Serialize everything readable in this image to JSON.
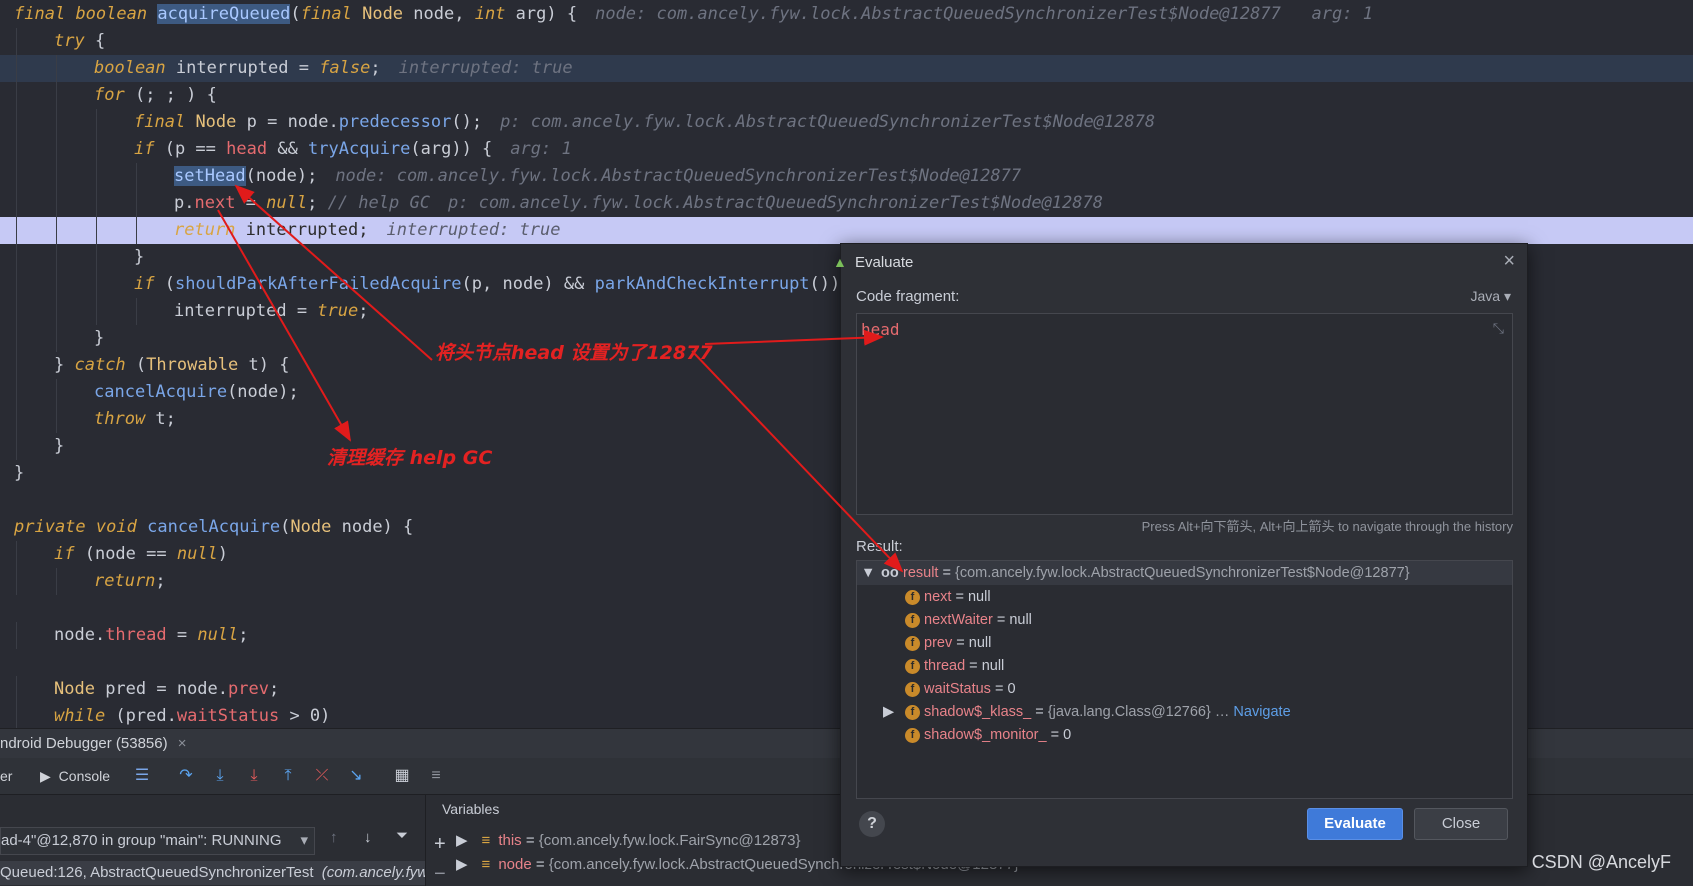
{
  "code_lines": [
    {
      "indent": 0,
      "parts": [
        [
          "kw",
          "final"
        ],
        [
          "t",
          " "
        ],
        [
          "kw",
          "boolean"
        ],
        [
          "t",
          " "
        ],
        [
          "hl",
          "acquireQueued"
        ],
        [
          "t",
          "("
        ],
        [
          "kw",
          "final"
        ],
        [
          "t",
          " "
        ],
        [
          "ty",
          "Node"
        ],
        [
          "t",
          " node, "
        ],
        [
          "kw",
          "int"
        ],
        [
          "t",
          " arg) {"
        ]
      ],
      "hint": "node: com.ancely.fyw.lock.AbstractQueuedSynchronizerTest$Node@12877   arg: 1"
    },
    {
      "indent": 1,
      "parts": [
        [
          "kw",
          "try"
        ],
        [
          "t",
          " {"
        ]
      ],
      "hint": ""
    },
    {
      "indent": 2,
      "parts": [
        [
          "kw",
          "boolean"
        ],
        [
          "t",
          " interrupted = "
        ],
        [
          "lit",
          "false"
        ],
        [
          "t",
          ";"
        ]
      ],
      "hint": "interrupted: true",
      "sel": true
    },
    {
      "indent": 2,
      "parts": [
        [
          "kw",
          "for"
        ],
        [
          "t",
          " (; ; ) {"
        ]
      ],
      "hint": ""
    },
    {
      "indent": 3,
      "parts": [
        [
          "kw",
          "final"
        ],
        [
          "t",
          " "
        ],
        [
          "ty",
          "Node"
        ],
        [
          "t",
          " p = node."
        ],
        [
          "fn",
          "predecessor"
        ],
        [
          "t",
          "();"
        ]
      ],
      "hint": "p: com.ancely.fyw.lock.AbstractQueuedSynchronizerTest$Node@12878"
    },
    {
      "indent": 3,
      "parts": [
        [
          "kw",
          "if"
        ],
        [
          "t",
          " (p == "
        ],
        [
          "fld",
          "head"
        ],
        [
          "t",
          " && "
        ],
        [
          "fn",
          "tryAcquire"
        ],
        [
          "t",
          "(arg)) {"
        ]
      ],
      "hint": "arg: 1"
    },
    {
      "indent": 4,
      "parts": [
        [
          "hl",
          "setHead"
        ],
        [
          "t",
          "(node);"
        ]
      ],
      "hint": "node: com.ancely.fyw.lock.AbstractQueuedSynchronizerTest$Node@12877"
    },
    {
      "indent": 4,
      "parts": [
        [
          "t",
          "p."
        ],
        [
          "fld",
          "next"
        ],
        [
          "t",
          " = "
        ],
        [
          "lit",
          "null"
        ],
        [
          "t",
          "; "
        ],
        [
          "hint0",
          "// help GC"
        ]
      ],
      "hint": "p: com.ancely.fyw.lock.AbstractQueuedSynchronizerTest$Node@12878"
    },
    {
      "indent": 4,
      "parts": [
        [
          "kw",
          "return"
        ],
        [
          "t",
          " interrupted;"
        ]
      ],
      "hint": "interrupted: true",
      "cur": true
    },
    {
      "indent": 3,
      "parts": [
        [
          "t",
          "}"
        ]
      ],
      "hint": ""
    },
    {
      "indent": 3,
      "parts": [
        [
          "kw",
          "if"
        ],
        [
          "t",
          " ("
        ],
        [
          "fn",
          "shouldParkAfterFailedAcquire"
        ],
        [
          "t",
          "(p, node) && "
        ],
        [
          "fn",
          "parkAndCheckInterrupt"
        ],
        [
          "t",
          "())"
        ]
      ],
      "hint": ""
    },
    {
      "indent": 4,
      "parts": [
        [
          "t",
          "interrupted = "
        ],
        [
          "lit",
          "true"
        ],
        [
          "t",
          ";"
        ]
      ],
      "hint": ""
    },
    {
      "indent": 2,
      "parts": [
        [
          "t",
          "}"
        ]
      ],
      "hint": ""
    },
    {
      "indent": 1,
      "parts": [
        [
          "t",
          "} "
        ],
        [
          "kw",
          "catch"
        ],
        [
          "t",
          " ("
        ],
        [
          "ty",
          "Throwable"
        ],
        [
          "t",
          " t) {"
        ]
      ],
      "hint": ""
    },
    {
      "indent": 2,
      "parts": [
        [
          "fn",
          "cancelAcquire"
        ],
        [
          "t",
          "(node);"
        ]
      ],
      "hint": ""
    },
    {
      "indent": 2,
      "parts": [
        [
          "kw",
          "throw"
        ],
        [
          "t",
          " t;"
        ]
      ],
      "hint": ""
    },
    {
      "indent": 1,
      "parts": [
        [
          "t",
          "}"
        ]
      ],
      "hint": ""
    },
    {
      "indent": 0,
      "parts": [
        [
          "t",
          "}"
        ]
      ],
      "hint": ""
    },
    {
      "indent": 0,
      "parts": [],
      "hint": ""
    },
    {
      "indent": 0,
      "parts": [
        [
          "kw",
          "private"
        ],
        [
          "t",
          " "
        ],
        [
          "kw",
          "void"
        ],
        [
          "t",
          " "
        ],
        [
          "fn",
          "cancelAcquire"
        ],
        [
          "t",
          "("
        ],
        [
          "ty",
          "Node"
        ],
        [
          "t",
          " node) {"
        ]
      ],
      "hint": ""
    },
    {
      "indent": 1,
      "parts": [
        [
          "kw",
          "if"
        ],
        [
          "t",
          " (node == "
        ],
        [
          "lit",
          "null"
        ],
        [
          "t",
          ")"
        ]
      ],
      "hint": ""
    },
    {
      "indent": 2,
      "parts": [
        [
          "kw",
          "return"
        ],
        [
          "t",
          ";"
        ]
      ],
      "hint": ""
    },
    {
      "indent": 0,
      "parts": [],
      "hint": ""
    },
    {
      "indent": 1,
      "parts": [
        [
          "t",
          "node."
        ],
        [
          "fld",
          "thread"
        ],
        [
          "t",
          " = "
        ],
        [
          "lit",
          "null"
        ],
        [
          "t",
          ";"
        ]
      ],
      "hint": ""
    },
    {
      "indent": 0,
      "parts": [],
      "hint": ""
    },
    {
      "indent": 1,
      "parts": [
        [
          "ty",
          "Node"
        ],
        [
          "t",
          " pred = node."
        ],
        [
          "fld",
          "prev"
        ],
        [
          "t",
          ";"
        ]
      ],
      "hint": ""
    },
    {
      "indent": 1,
      "parts": [
        [
          "kw",
          "while"
        ],
        [
          "t",
          " (pred."
        ],
        [
          "fld",
          "waitStatus"
        ],
        [
          "t",
          " > 0)"
        ]
      ],
      "hint": ""
    }
  ],
  "annotations": {
    "set_head": "将头节点head 设置为了12877",
    "help_gc": "清理缓存 help GC"
  },
  "debugger": {
    "tab_label": "ndroid Debugger (53856)",
    "tab_close": "×",
    "left_stub": "er",
    "console_label": "Console",
    "thread_label": "ad-4\"@12,870 in group \"main\": RUNNING",
    "frame_label": "Queued:126, AbstractQueuedSynchronizerTest",
    "frame_class": "(com.ancely.fyw.l",
    "variables_title": "Variables",
    "variables": [
      {
        "name": "this",
        "value": "{com.ancely.fyw.lock.FairSync@12873}"
      },
      {
        "name": "node",
        "value": "{com.ancely.fyw.lock.AbstractQueuedSynchronizerTest$Node@12877}"
      }
    ]
  },
  "dialog": {
    "title": "Evaluate",
    "code_fragment_label": "Code fragment:",
    "language": "Java",
    "fragment": "head",
    "history_hint": "Press Alt+向下箭头, Alt+向上箭头 to navigate through the history",
    "result_label": "Result:",
    "result": {
      "name": "result",
      "value": "{com.ancely.fyw.lock.AbstractQueuedSynchronizerTest$Node@12877}"
    },
    "fields": [
      {
        "name": "next",
        "value": "null",
        "expandable": false
      },
      {
        "name": "nextWaiter",
        "value": "null",
        "expandable": false
      },
      {
        "name": "prev",
        "value": "null",
        "expandable": false
      },
      {
        "name": "thread",
        "value": "null",
        "expandable": false
      },
      {
        "name": "waitStatus",
        "value": "0",
        "expandable": false
      },
      {
        "name": "shadow$_klass_",
        "value": "{java.lang.Class@12766}",
        "expandable": true,
        "link": "Navigate"
      },
      {
        "name": "shadow$_monitor_",
        "value": "0",
        "expandable": false
      }
    ],
    "evaluate_button": "Evaluate",
    "close_button": "Close",
    "help_button": "?"
  },
  "watermark": "CSDN @AncelyF"
}
